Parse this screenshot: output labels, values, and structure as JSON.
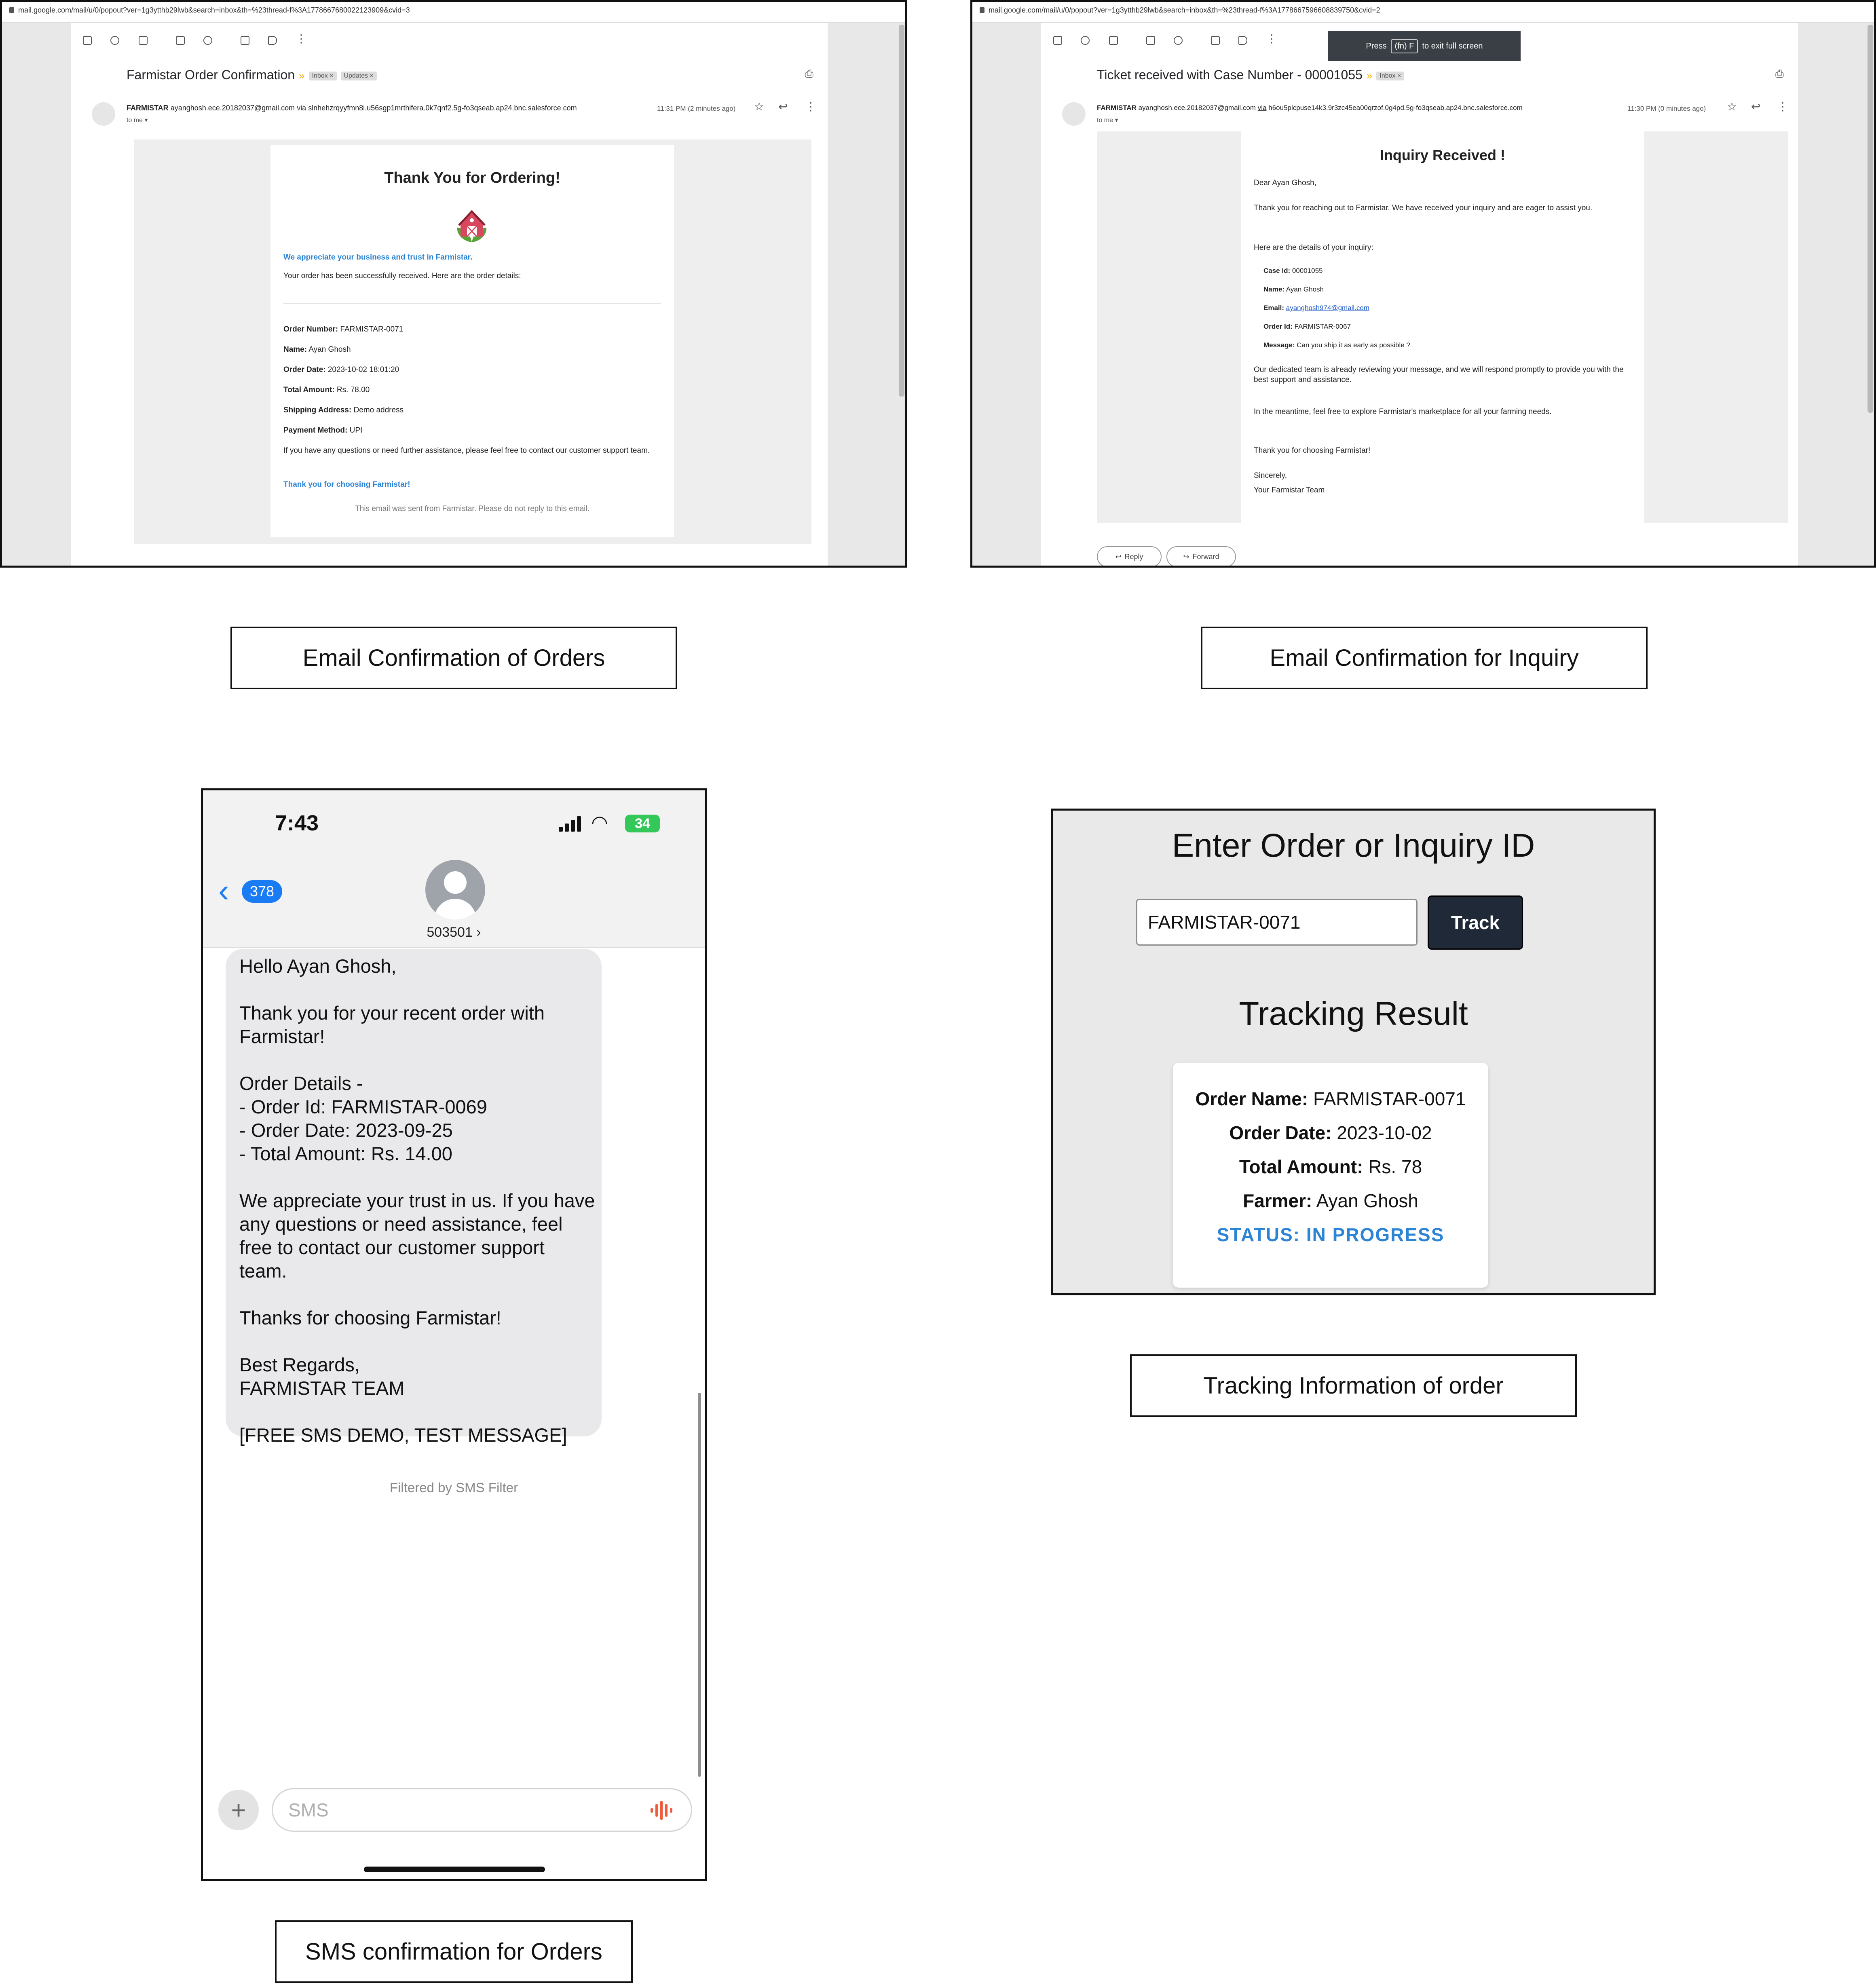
{
  "order_email": {
    "url": "mail.google.com/mail/u/0/popout?ver=1g3ytthb29lwb&search=inbox&th=%23thread-f%3A1778667680022123909&cvid=3",
    "subject": "Farmistar Order Confirmation",
    "labels": [
      "Inbox",
      "Updates"
    ],
    "sender_name": "FARMISTAR",
    "sender_email": "ayanghosh.ece.20182037@gmail.com",
    "via_text": "via",
    "via_address": "slnhehzrqyyfmn8i.u56sgp1mrthifera.0k7qnf2.5g-fo3qseab.ap24.bnc.salesforce.com",
    "to_me": "to me",
    "timestamp": "11:31 PM (2 minutes ago)",
    "card": {
      "title": "Thank You for Ordering!",
      "appreciate": "We appreciate your business and trust in Farmistar.",
      "received": "Your order has been successfully received. Here are the order details:",
      "fields": [
        {
          "label": "Order Number:",
          "value": "FARMISTAR-0071"
        },
        {
          "label": "Name:",
          "value": "Ayan Ghosh"
        },
        {
          "label": "Order Date:",
          "value": "2023-10-02 18:01:20"
        },
        {
          "label": "Total Amount:",
          "value": "Rs. 78.00"
        },
        {
          "label": "Shipping Address:",
          "value": "Demo address"
        },
        {
          "label": "Payment Method:",
          "value": "UPI"
        }
      ],
      "questions": "If you have any questions or need further assistance, please feel free to contact our customer support team.",
      "thanks": "Thank you for choosing Farmistar!",
      "footer": "This email was sent from Farmistar. Please do not reply to this email."
    }
  },
  "inquiry_email": {
    "url": "mail.google.com/mail/u/0/popout?ver=1g3ytthb29lwb&search=inbox&th=%23thread-f%3A1778667596608839750&cvid=2",
    "fullscreen_toast": {
      "press": "Press",
      "key": "(fn) F",
      "rest": "to exit full screen"
    },
    "subject": "Ticket received with Case Number - 00001055",
    "labels": [
      "Inbox"
    ],
    "sender_name": "FARMISTAR",
    "sender_email": "ayanghosh.ece.20182037@gmail.com",
    "via_text": "via",
    "via_address": "h6ou5plcpuse14k3.9r3zc45ea00qrzof.0g4pd.5g-fo3qseab.ap24.bnc.salesforce.com",
    "to_me": "to me",
    "timestamp": "11:30 PM (0 minutes ago)",
    "card": {
      "title": "Inquiry Received !",
      "greeting": "Dear Ayan Ghosh,",
      "intro": "Thank you for reaching out to Farmistar. We have received your inquiry and are eager to assist you.",
      "details_intro": "Here are the details of your inquiry:",
      "fields": [
        {
          "label": "Case Id:",
          "value": "00001055"
        },
        {
          "label": "Name:",
          "value": "Ayan Ghosh"
        },
        {
          "label": "Email:",
          "value": "ayanghosh974@gmail.com"
        },
        {
          "label": "Order Id:",
          "value": "FARMISTAR-0067"
        },
        {
          "label": "Message:",
          "value": "Can you ship it as early as possible ?"
        }
      ],
      "team_line": "Our dedicated team is already reviewing your message, and we will respond promptly to provide you with the best support and assistance.",
      "meantime": "In the meantime, feel free to explore Farmistar's marketplace for all your farming needs.",
      "thanks": "Thank you for choosing Farmistar!",
      "sincerely": "Sincerely,",
      "team": "Your Farmistar Team"
    },
    "reply_label": "Reply",
    "forward_label": "Forward"
  },
  "captions": {
    "orders_email": "Email Confirmation of Orders",
    "inquiry_email": "Email Confirmation for Inquiry",
    "sms": "SMS confirmation for Orders",
    "tracking": "Tracking Information of order"
  },
  "sms": {
    "time": "7:43",
    "battery": "34",
    "back_count": "378",
    "contact": "503501",
    "message": "Hello Ayan Ghosh,\n\nThank you for your recent order with Farmistar!\n\nOrder Details -\n- Order Id: FARMISTAR-0069\n- Order Date: 2023-09-25\n- Total Amount: Rs. 14.00\n\nWe appreciate your trust in us. If you have any questions or need assistance, feel free to contact our customer support team.\n\nThanks for choosing Farmistar!\n\nBest Regards,\nFARMISTAR TEAM\n\n[FREE SMS DEMO, TEST MESSAGE]",
    "filtered": "Filtered by SMS Filter",
    "placeholder": "SMS"
  },
  "tracker": {
    "heading": "Enter Order or Inquiry ID",
    "input_value": "FARMISTAR-0071",
    "button": "Track",
    "result_heading": "Tracking Result",
    "rows": [
      {
        "label": "Order Name:",
        "value": "FARMISTAR-0071"
      },
      {
        "label": "Order Date:",
        "value": "2023-10-02"
      },
      {
        "label": "Total Amount:",
        "value": "Rs. 78"
      },
      {
        "label": "Farmer:",
        "value": "Ayan Ghosh"
      }
    ],
    "status": "STATUS: IN PROGRESS"
  },
  "colors": {
    "accent_blue": "#2b84d6",
    "track_button": "#1f2937",
    "ios_blue": "#1a7cf5",
    "battery_green": "#34c759",
    "important_marker": "#f2b400"
  }
}
